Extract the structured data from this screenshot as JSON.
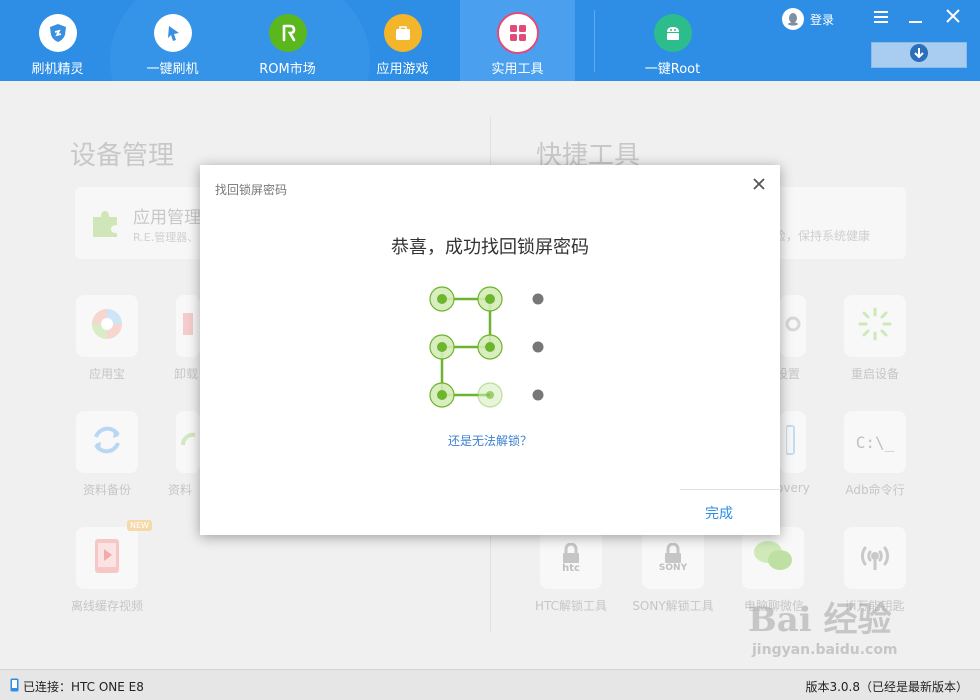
{
  "nav": {
    "items": [
      {
        "label": "刷机精灵",
        "icon": "shield-icon",
        "color": "#3a8fe0"
      },
      {
        "label": "一键刷机",
        "icon": "cursor-icon",
        "color": "#3a8fe0"
      },
      {
        "label": "ROM市场",
        "icon": "rom-icon",
        "color": "#5ab81e"
      },
      {
        "label": "应用游戏",
        "icon": "bag-icon",
        "color": "#f3b52a"
      },
      {
        "label": "实用工具",
        "icon": "tools-icon",
        "color": "#e24a7a"
      },
      {
        "label": "一键Root",
        "icon": "android-icon",
        "color": "#2dbd8d"
      }
    ],
    "login_label": "登录"
  },
  "left_section": {
    "title": "设备管理",
    "card": {
      "title": "应用管理",
      "subtitle": "R.E.管理器、"
    },
    "tiles": [
      {
        "label": "应用宝",
        "icon": "yingyongbao-icon"
      },
      {
        "label": "卸载",
        "icon": "uninstall-icon"
      },
      {
        "label": "资料备份",
        "icon": "backup-icon"
      },
      {
        "label": "资料",
        "icon": "restore-icon"
      },
      {
        "label": "离线缓存视频",
        "icon": "video-icon",
        "badge": "NEW"
      }
    ]
  },
  "right_section": {
    "title": "快捷工具",
    "card_subtitle": "检，保持系统健康",
    "tiles": [
      {
        "label": "设置",
        "icon": "gear-icon"
      },
      {
        "label": "重启设备",
        "icon": "restart-icon"
      },
      {
        "label": "overy",
        "icon": "recovery-icon"
      },
      {
        "label": "Adb命令行",
        "icon": "terminal-icon",
        "glyph": "C:\\_"
      },
      {
        "label": "HTC解锁工具",
        "icon": "htc-lock-icon",
        "glyph": "htc"
      },
      {
        "label": "SONY解锁工具",
        "icon": "sony-lock-icon",
        "glyph": "SONY"
      },
      {
        "label": "电脑聊微信",
        "icon": "wechat-icon"
      },
      {
        "label": "ifi万能钥匙",
        "icon": "wifi-key-icon"
      }
    ]
  },
  "modal": {
    "title": "找回锁屏密码",
    "heading": "恭喜，成功找回锁屏密码",
    "help_link": "还是无法解锁？",
    "done_label": "完成",
    "pattern_order": [
      [
        0,
        0
      ],
      [
        1,
        0
      ],
      [
        1,
        1
      ],
      [
        0,
        1
      ],
      [
        0,
        2
      ],
      [
        1,
        2
      ]
    ]
  },
  "status": {
    "connected": "已连接：HTC ONE E8",
    "version": "版本3.0.8（已经是最新版本）"
  },
  "watermark": {
    "big": "Bai 经验",
    "small": "jingyan.baidu.com"
  },
  "colors": {
    "primary": "#2e8ee6",
    "pattern_green": "#6cb52d",
    "pattern_light": "#d4ecb8"
  }
}
